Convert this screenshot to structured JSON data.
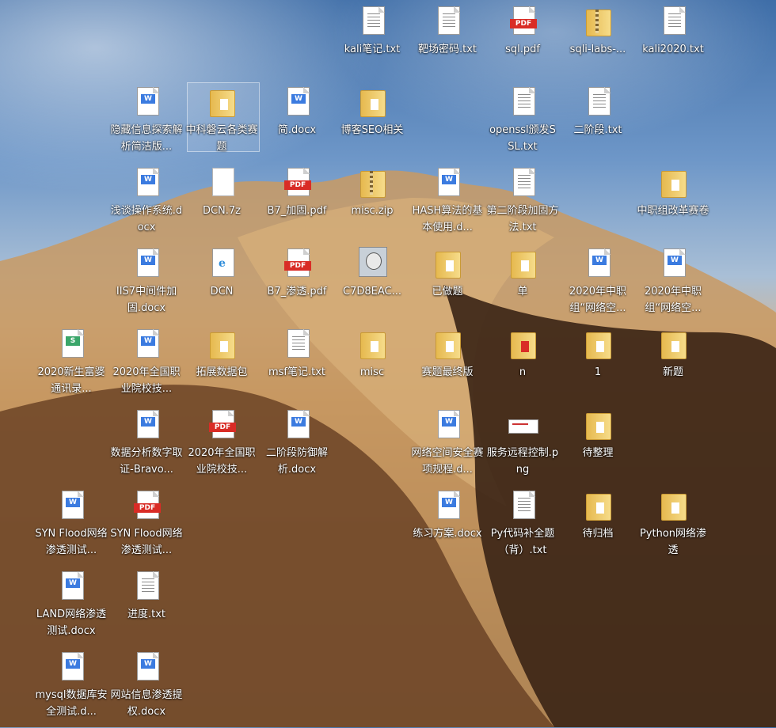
{
  "desktop": {
    "icons": [
      {
        "label": "kali笔记.txt",
        "type": "txt"
      },
      {
        "label": "靶场密码.txt",
        "type": "txt"
      },
      {
        "label": "sql.pdf",
        "type": "pdf"
      },
      {
        "label": "sqli-labs-...",
        "type": "zip"
      },
      {
        "label": "kali2020.txt",
        "type": "txt"
      },
      {
        "label": "隐藏信息探索解析简洁版...",
        "type": "docx"
      },
      {
        "label": "中科磐云各类赛题",
        "type": "folder"
      },
      {
        "label": "简.docx",
        "type": "docx"
      },
      {
        "label": "博客SEO相关",
        "type": "folder"
      },
      {
        "label": "openssl颁发SSL.txt",
        "type": "txt"
      },
      {
        "label": "二阶段.txt",
        "type": "txt"
      },
      {
        "label": "浅谈操作系统.docx",
        "type": "docx"
      },
      {
        "label": "DCN.7z",
        "type": "blank"
      },
      {
        "label": "B7_加固.pdf",
        "type": "pdf"
      },
      {
        "label": "misc.zip",
        "type": "zip"
      },
      {
        "label": "HASH算法的基本使用.d...",
        "type": "docx"
      },
      {
        "label": "第二阶段加固方法.txt",
        "type": "txt"
      },
      {
        "label": "中职组改革赛卷",
        "type": "folder"
      },
      {
        "label": "IIS7中间件加固.docx",
        "type": "docx"
      },
      {
        "label": "DCN",
        "type": "edge"
      },
      {
        "label": "B7_渗透.pdf",
        "type": "pdf"
      },
      {
        "label": "C7D8EAC...",
        "type": "photo"
      },
      {
        "label": "已做题",
        "type": "folder"
      },
      {
        "label": "单",
        "type": "folder"
      },
      {
        "label": "2020年中职组“网络空...",
        "type": "docx"
      },
      {
        "label": "2020年中职组“网络空...",
        "type": "docx"
      },
      {
        "label": "2020新生富婆通讯录...",
        "type": "xls"
      },
      {
        "label": "2020年全国职业院校技...",
        "type": "docx"
      },
      {
        "label": "拓展数据包",
        "type": "folder"
      },
      {
        "label": "msf笔记.txt",
        "type": "txt"
      },
      {
        "label": "misc",
        "type": "folder"
      },
      {
        "label": "赛题最终版",
        "type": "folder"
      },
      {
        "label": "n",
        "type": "pdf-folder"
      },
      {
        "label": "1",
        "type": "folder"
      },
      {
        "label": "新题",
        "type": "folder"
      },
      {
        "label": "数据分析数字取证-Bravo...",
        "type": "docx"
      },
      {
        "label": "2020年全国职业院校技...",
        "type": "pdf"
      },
      {
        "label": "二阶段防御解析.docx",
        "type": "docx"
      },
      {
        "label": "网络空间安全赛项规程.d...",
        "type": "docx"
      },
      {
        "label": "服务远程控制.png",
        "type": "png"
      },
      {
        "label": "待整理",
        "type": "folder"
      },
      {
        "label": "SYN Flood网络渗透测试...",
        "type": "docx"
      },
      {
        "label": "SYN Flood网络渗透测试...",
        "type": "pdf"
      },
      {
        "label": "练习方案.docx",
        "type": "docx"
      },
      {
        "label": "Py代码补全题（背）.txt",
        "type": "txt"
      },
      {
        "label": "待归档",
        "type": "folder"
      },
      {
        "label": "Python网络渗透",
        "type": "folder"
      },
      {
        "label": "LAND网络渗透测试.docx",
        "type": "docx"
      },
      {
        "label": "进度.txt",
        "type": "txt"
      },
      {
        "label": "mysql数据库安全测试.d...",
        "type": "docx"
      },
      {
        "label": "网站信息渗透提权.docx",
        "type": "docx"
      }
    ],
    "badges": {
      "pdf": "PDF",
      "docx": "W",
      "xls": "S"
    }
  }
}
